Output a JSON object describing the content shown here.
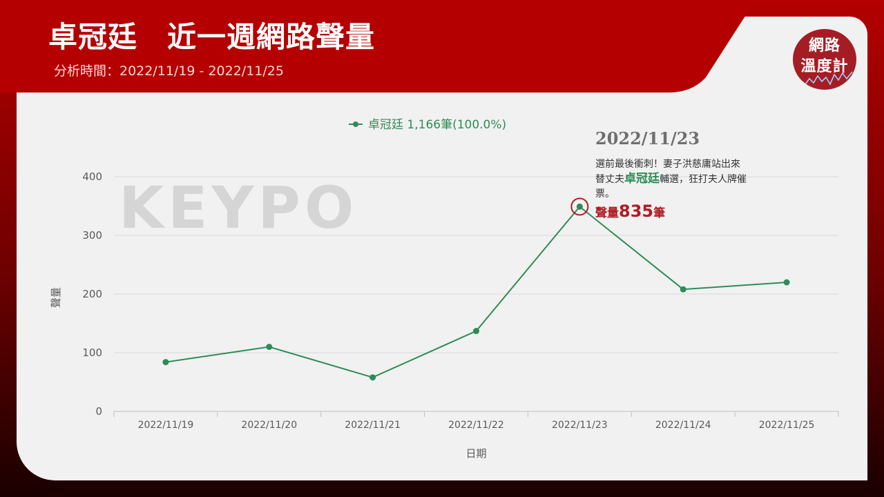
{
  "header": {
    "title": "卓冠廷　近一週網路聲量",
    "period": "分析時間：2022/11/19 - 2022/11/25"
  },
  "logo": {
    "line1": "網路",
    "line2": "溫度計"
  },
  "watermark": "KEYPO",
  "colors": {
    "brand_red": "#b40000",
    "series": "#2e8b57",
    "highlight": "#b01c24"
  },
  "annotation": {
    "date": "2022/11/23",
    "text_pre": "選前最後衝刺！妻子洪慈庸站出來替丈夫",
    "text_highlight": "卓冠廷",
    "text_post": "輔選，狂打夫人牌催票。",
    "volume_prefix": "聲量",
    "volume_value": "835",
    "volume_suffix": "筆"
  },
  "chart_data": {
    "type": "line",
    "categories": [
      "2022/11/19",
      "2022/11/20",
      "2022/11/21",
      "2022/11/22",
      "2022/11/23",
      "2022/11/24",
      "2022/11/25"
    ],
    "series": [
      {
        "name": "卓冠廷 1,166筆(100.0%)",
        "values": [
          84,
          110,
          58,
          137,
          349,
          208,
          220
        ]
      }
    ],
    "xlabel": "日期",
    "ylabel": "聲量",
    "ylim": [
      0,
      400
    ],
    "yticks": [
      0,
      100,
      200,
      300,
      400
    ],
    "grid": true,
    "legend": "top",
    "highlight_category": "2022/11/23"
  }
}
